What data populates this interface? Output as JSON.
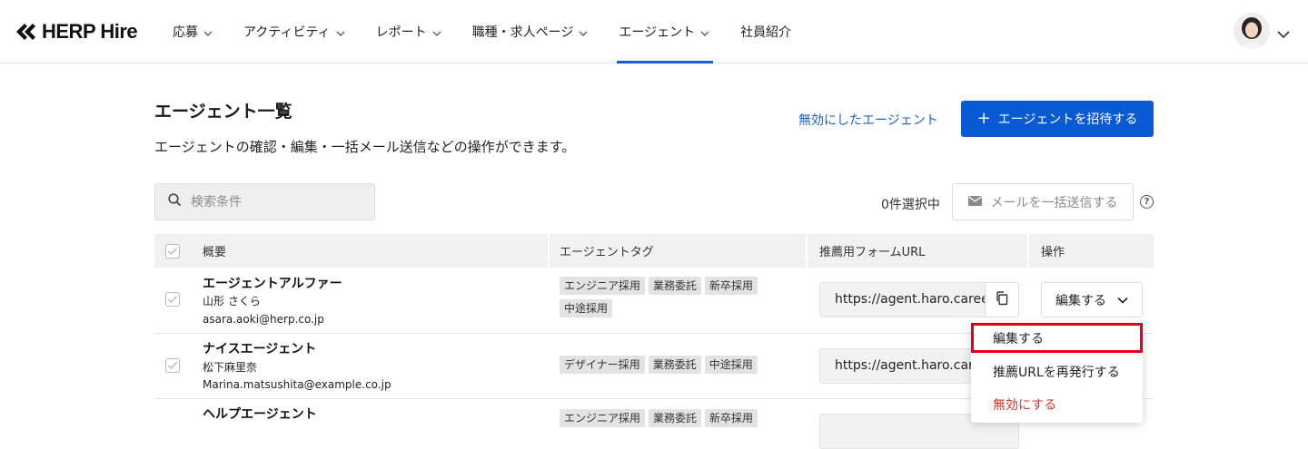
{
  "header": {
    "logo_text": "HERP Hire",
    "nav": [
      {
        "label": "応募",
        "has_menu": true
      },
      {
        "label": "アクティビティ",
        "has_menu": true
      },
      {
        "label": "レポート",
        "has_menu": true
      },
      {
        "label": "職種・求人ページ",
        "has_menu": true
      },
      {
        "label": "エージェント",
        "has_menu": true,
        "active": true
      },
      {
        "label": "社員紹介",
        "has_menu": false
      }
    ]
  },
  "page": {
    "title": "エージェント一覧",
    "description": "エージェントの確認・編集・一括メール送信などの操作ができます。",
    "disabled_agents_link": "無効にしたエージェント",
    "invite_button": "エージェントを招待する"
  },
  "toolbar": {
    "search_placeholder": "検索条件",
    "selected_count": "0件選択中",
    "bulk_mail_button": "メールを一括送信する"
  },
  "table": {
    "columns": [
      "概要",
      "エージェントタグ",
      "推薦用フォームURL",
      "操作"
    ],
    "rows": [
      {
        "name": "エージェントアルファー",
        "person": "山形 さくら",
        "email": "asara.aoki@herp.co.jp",
        "tags": [
          "エンジニア採用",
          "業務委託",
          "新卒採用",
          "中途採用"
        ],
        "url": "https://agent.haro.careers/",
        "action": "編集する"
      },
      {
        "name": "ナイスエージェント",
        "person": "松下麻里奈",
        "email": "Marina.matsushita@example.co.jp",
        "tags": [
          "デザイナー採用",
          "業務委託",
          "中途採用"
        ],
        "url": "https://agent.haro.careers/",
        "action": "編集する"
      },
      {
        "name": "ヘルプエージェント",
        "person": "",
        "email": "",
        "tags": [
          "エンジニア採用",
          "業務委託",
          "新卒採用"
        ],
        "url": "",
        "action": ""
      }
    ]
  },
  "dropdown": {
    "items": [
      {
        "label": "編集する",
        "highlighted": true
      },
      {
        "label": "推薦URLを再発行する"
      },
      {
        "label": "無効にする",
        "danger": true
      }
    ]
  },
  "colors": {
    "primary": "#0a5ad4",
    "link": "#1a5fd1",
    "danger": "#e0312b",
    "highlight_border": "#e0001a"
  }
}
